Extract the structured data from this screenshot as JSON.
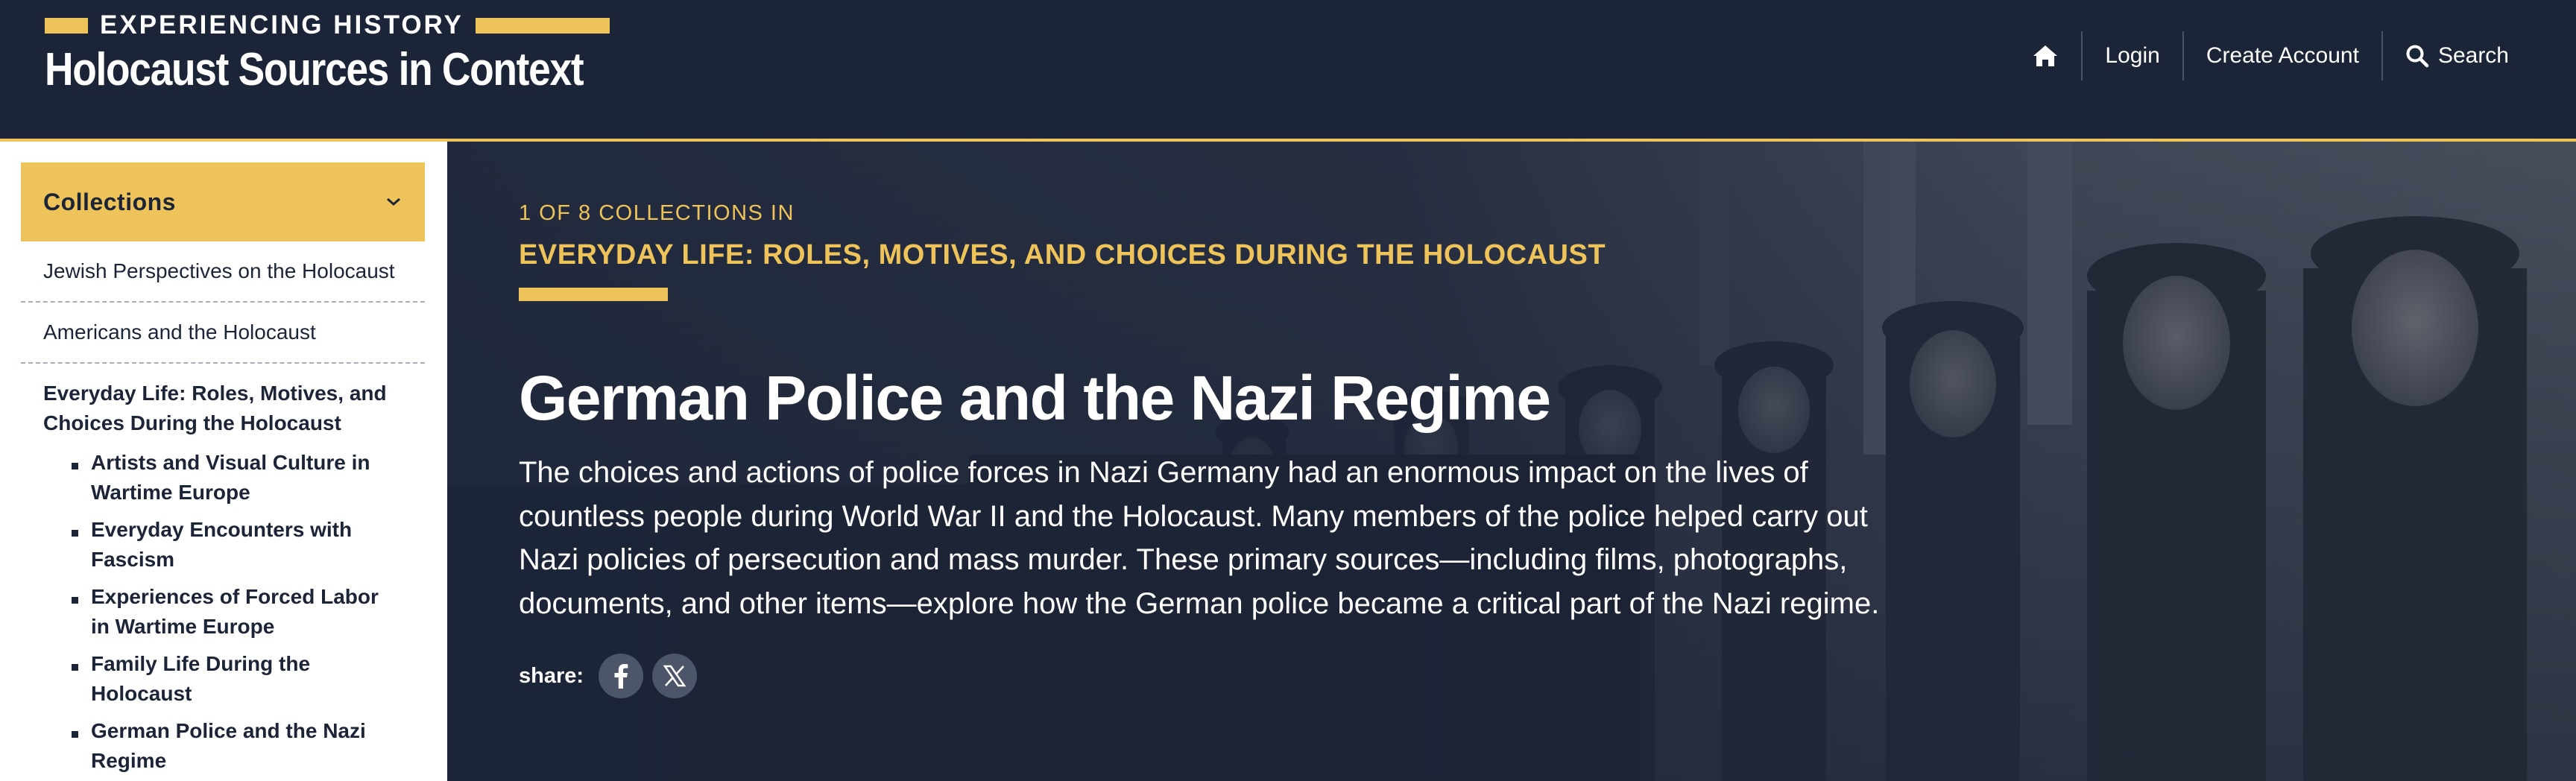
{
  "header": {
    "kicker": "EXPERIENCING HISTORY",
    "title": "Holocaust Sources in Context",
    "nav": {
      "home_icon": "home-icon",
      "login": "Login",
      "create_account": "Create Account",
      "search": "Search",
      "search_icon": "search-icon"
    }
  },
  "sidebar": {
    "toggle_label": "Collections",
    "toggle_icon": "chevron-down-icon",
    "items": [
      {
        "label": "Jewish Perspectives on the Holocaust"
      },
      {
        "label": "Americans and the Holocaust"
      },
      {
        "label": "Everyday Life: Roles, Motives, and Choices During the Holocaust"
      }
    ],
    "sub_items": [
      {
        "label": "Artists and Visual Culture in Wartime Europe"
      },
      {
        "label": "Everyday Encounters with Fascism"
      },
      {
        "label": "Experiences of Forced Labor in Wartime Europe"
      },
      {
        "label": "Family Life During the Holocaust"
      },
      {
        "label": "German Police and the Nazi Regime"
      }
    ]
  },
  "hero": {
    "kicker": "1 OF 8 COLLECTIONS IN",
    "collection": "EVERYDAY LIFE: ROLES, MOTIVES, AND CHOICES DURING THE HOLOCAUST",
    "title": "German Police and the Nazi Regime",
    "description": "The choices and actions of police forces in Nazi Germany had an enormous impact on the lives of countless people during World War II and the Holocaust. Many members of the police helped carry out Nazi policies of persecution and mass murder. These primary sources—including films, photographs, documents, and other items—explore how the German police became a critical part of the Nazi regime.",
    "share_label": "share:",
    "share_icons": [
      "facebook-icon",
      "x-icon"
    ]
  },
  "colors": {
    "navy": "#1c2438",
    "gold": "#eec45a",
    "white": "#ffffff"
  }
}
